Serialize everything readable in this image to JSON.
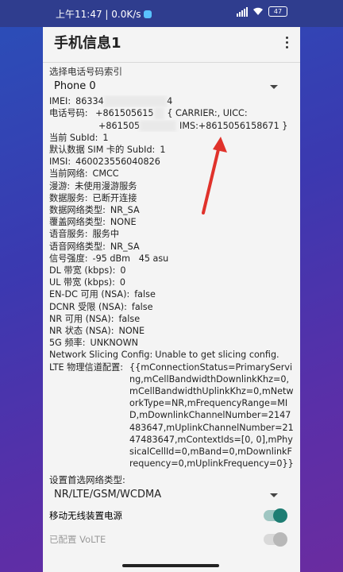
{
  "statusbar": {
    "time": "上午11:47 | 0.0K/s",
    "battery": "47"
  },
  "app": {
    "title": "手机信息1"
  },
  "phone_index": {
    "label": "选择电话号码索引",
    "value": "Phone 0"
  },
  "info": {
    "imei_key": "IMEI:",
    "imei_a": "86334",
    "imei_b": "4",
    "phone_key": "电话号码:",
    "phone_l1a": "+861505615",
    "phone_l1b": "{ CARRIER:, UICC:",
    "phone_l2a": "+861505",
    "phone_l2b": "IMS:+8615056158671 }",
    "subid_key": "当前 SubId:",
    "subid_val": "1",
    "datasim_key": "默认数据 SIM 卡的 SubId:",
    "datasim_val": "1",
    "imsi_key": "IMSI:",
    "imsi_val": "460023556040826",
    "network_key": "当前网络:",
    "network_val": "CMCC",
    "roaming_key": "漫游:",
    "roaming_val": "未使用漫游服务",
    "data_key": "数据服务:",
    "data_val": "已断开连接",
    "datanet_key": "数据网络类型:",
    "datanet_val": "NR_SA",
    "overlay_key": "覆盖网络类型:",
    "overlay_val": "NONE",
    "voice_key": "语音服务:",
    "voice_val": "服务中",
    "voicenet_key": "语音网络类型:",
    "voicenet_val": "NR_SA",
    "signal_key": "信号强度:",
    "signal_val": "-95 dBm   45 asu",
    "dl_key": "DL 带宽 (kbps):",
    "dl_val": "0",
    "ul_key": "UL 带宽 (kbps):",
    "ul_val": "0",
    "endc_key": "EN-DC 可用 (NSA):",
    "endc_val": "false",
    "dcnr_key": "DCNR 受限 (NSA):",
    "dcnr_val": "false",
    "nr_avail_key": "NR 可用 (NSA):",
    "nr_avail_val": "false",
    "nr_state_key": "NR 状态 (NSA):",
    "nr_state_val": "NONE",
    "freq_key": "5G 频率:",
    "freq_val": "UNKNOWN",
    "slicing_key": "Network Slicing Config:",
    "slicing_val": "Unable to get slicing config.",
    "lte_key": "LTE 物理信道配置:",
    "lte_val": "{{mConnectionStatus=PrimaryServing,mCellBandwidthDownlinkKhz=0,mCellBandwidthUplinkKhz=0,mNetworkType=NR,mFrequencyRange=MID,mDownlinkChannelNumber=2147483647,mUplinkChannelNumber=2147483647,mContextIds=[0, 0],mPhysicalCellId=0,mBand=0,mDownlinkFrequency=0,mUplinkFrequency=0}}"
  },
  "network_type": {
    "label": "设置首选网络类型:",
    "value": "NR/LTE/GSM/WCDMA"
  },
  "toggles": [
    {
      "label": "移动无线装置电源",
      "state": "on"
    },
    {
      "label": "已配置 VoLTE",
      "state": "off-disabled"
    }
  ],
  "colors": {
    "accent": "#1e7d73",
    "arrow": "#e0322b"
  }
}
